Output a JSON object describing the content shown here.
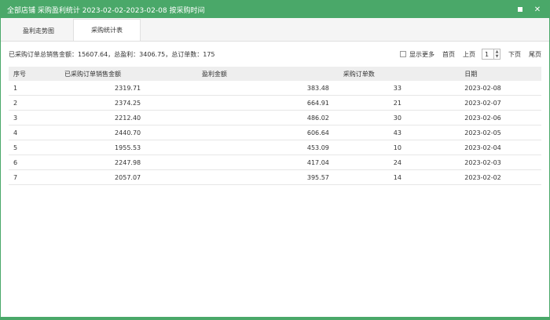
{
  "window": {
    "title": "全部店铺 采购盈利统计 2023-02-02-2023-02-08 按采购时间",
    "min_glyph": "■",
    "close_glyph": "✕"
  },
  "tabs": [
    {
      "label": "盈利走势图",
      "active": false
    },
    {
      "label": "采购统计表",
      "active": true
    }
  ],
  "summary": "已采购订单总销售金额：15607.64，总盈利：3406.75，总订单数：175",
  "pager": {
    "show_more": "显示更多",
    "first": "首页",
    "prev": "上页",
    "page": "1",
    "next": "下页",
    "last": "尾页"
  },
  "table": {
    "headers": [
      "序号",
      "已采购订单销售金额",
      "盈利金额",
      "采购订单数",
      "日期"
    ],
    "rows": [
      [
        "1",
        "2319.71",
        "383.48",
        "33",
        "2023-02-08"
      ],
      [
        "2",
        "2374.25",
        "664.91",
        "21",
        "2023-02-07"
      ],
      [
        "3",
        "2212.40",
        "486.02",
        "30",
        "2023-02-06"
      ],
      [
        "4",
        "2440.70",
        "606.64",
        "43",
        "2023-02-05"
      ],
      [
        "5",
        "1955.53",
        "453.09",
        "10",
        "2023-02-04"
      ],
      [
        "6",
        "2247.98",
        "417.04",
        "24",
        "2023-02-03"
      ],
      [
        "7",
        "2057.07",
        "395.57",
        "14",
        "2023-02-02"
      ]
    ]
  },
  "colors": {
    "accent": "#4aa869",
    "header_bg": "#eeeeee"
  }
}
